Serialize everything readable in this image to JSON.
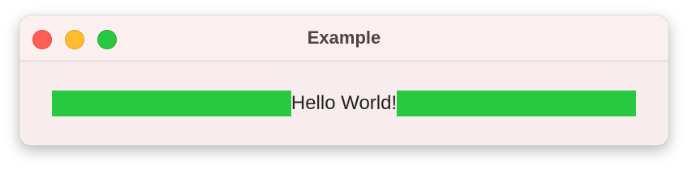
{
  "window": {
    "title": "Example"
  },
  "content": {
    "label": "Hello World!"
  },
  "colors": {
    "spacer": "#28c840",
    "close": "#ff5f57",
    "minimize": "#febc2e",
    "zoom": "#28c840"
  },
  "icons": {
    "close": "close-button-icon",
    "minimize": "minimize-button-icon",
    "zoom": "zoom-button-icon"
  }
}
